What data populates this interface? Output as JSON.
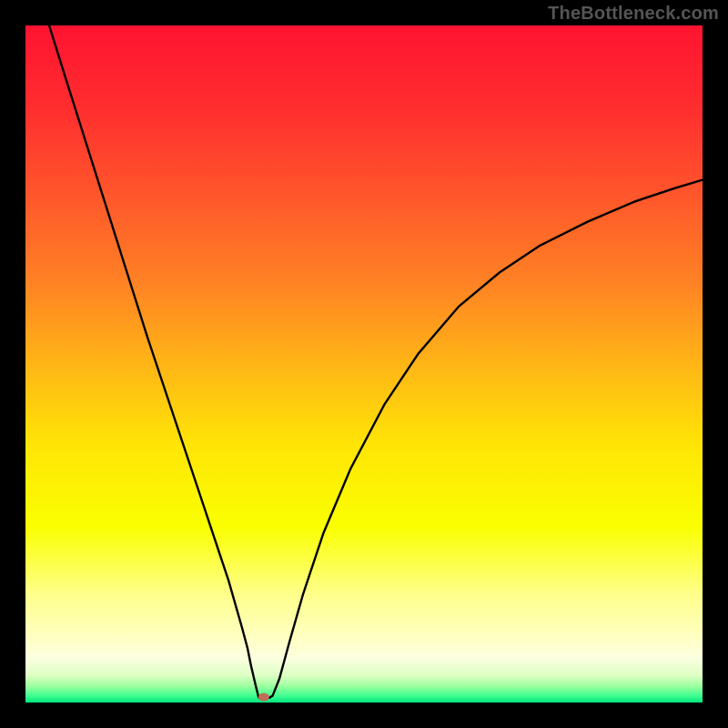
{
  "attribution": "TheBottleneck.com",
  "chart_data": {
    "type": "line",
    "title": "",
    "xlabel": "",
    "ylabel": "",
    "xlim": [
      0,
      100
    ],
    "ylim": [
      0,
      100
    ],
    "grid": false,
    "legend": false,
    "background_gradient": {
      "stops": [
        {
          "offset": 0.0,
          "color": "#ff1330"
        },
        {
          "offset": 0.12,
          "color": "#ff2d2f"
        },
        {
          "offset": 0.25,
          "color": "#ff562b"
        },
        {
          "offset": 0.38,
          "color": "#ff8224"
        },
        {
          "offset": 0.5,
          "color": "#ffb516"
        },
        {
          "offset": 0.62,
          "color": "#ffe506"
        },
        {
          "offset": 0.74,
          "color": "#faff00"
        },
        {
          "offset": 0.84,
          "color": "#feff8a"
        },
        {
          "offset": 0.9,
          "color": "#ffffbf"
        },
        {
          "offset": 0.935,
          "color": "#fbffe0"
        },
        {
          "offset": 0.96,
          "color": "#ddffc4"
        },
        {
          "offset": 0.975,
          "color": "#a0ffa0"
        },
        {
          "offset": 0.99,
          "color": "#40ff90"
        },
        {
          "offset": 1.0,
          "color": "#00e57e"
        }
      ]
    },
    "series": [
      {
        "name": "bottleneck-curve",
        "color": "#000000",
        "x": [
          3.5,
          6,
          9,
          12,
          15,
          18,
          21,
          24,
          26,
          28,
          30,
          31,
          32,
          32.8,
          33.3,
          34.0,
          34.4,
          34.5,
          36.0,
          36.5,
          37.5,
          39,
          41,
          44,
          48,
          53,
          58,
          64,
          70,
          76,
          83,
          90,
          96,
          100
        ],
        "y": [
          100,
          92,
          82.5,
          73,
          63.5,
          54,
          45,
          36,
          30,
          24,
          18,
          14.5,
          11,
          8,
          5.5,
          2.5,
          0.9,
          0.7,
          0.7,
          1.0,
          3.5,
          9,
          16,
          25,
          34.5,
          44,
          51.5,
          58.5,
          63.5,
          67.5,
          71,
          74,
          76,
          77.2
        ]
      }
    ],
    "marker": {
      "name": "optimal-point",
      "x": 35.2,
      "y": 0.8,
      "color": "#c26b57",
      "rx": 6,
      "ry": 4.5
    }
  }
}
